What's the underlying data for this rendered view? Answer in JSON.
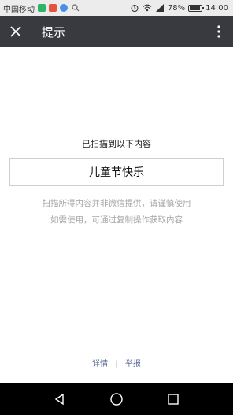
{
  "status_bar": {
    "carrier": "中国移动",
    "battery": "78%",
    "time": "14:00"
  },
  "header": {
    "title": "提示"
  },
  "scan": {
    "heading": "已扫描到以下内容",
    "result": "儿童节快乐",
    "notice_line1": "扫描所得内容并非微信提供，请谨慎使用",
    "notice_line2": "如需使用，可通过复制操作获取内容"
  },
  "footer": {
    "details_label": "详情",
    "separator": "|",
    "report_label": "举报"
  },
  "colors": {
    "title_bar_bg": "#393a3f",
    "link": "#576b95",
    "notice": "#a6a6a6"
  }
}
